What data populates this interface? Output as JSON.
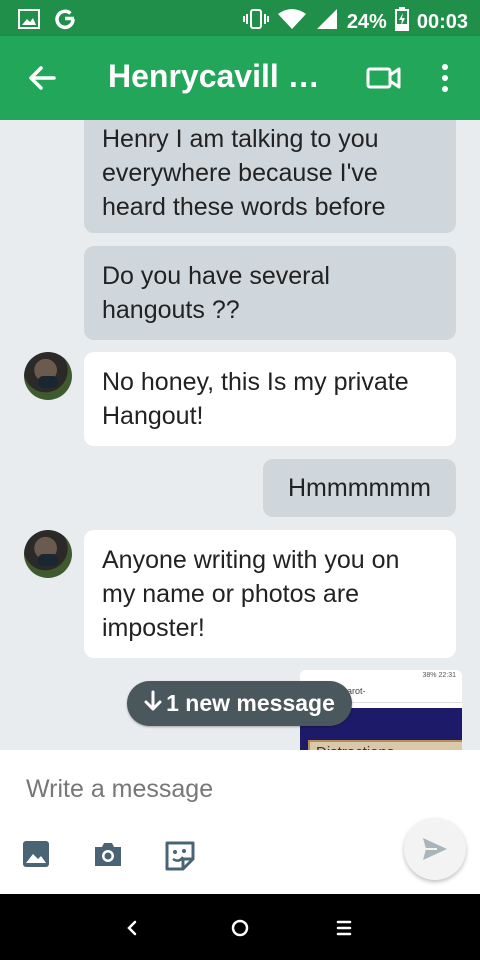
{
  "status_bar": {
    "battery_percent": "24%",
    "time": "00:03",
    "icons": [
      "gallery-icon",
      "google-g-icon",
      "vibrate-icon",
      "wifi-icon",
      "cell-signal-icon",
      "battery-charging-icon"
    ]
  },
  "header": {
    "title": "Henrycavill O...",
    "icons": [
      "back-arrow-icon",
      "video-call-icon",
      "more-vert-icon"
    ]
  },
  "messages": [
    {
      "direction": "out",
      "text": "Henry I am talking to you everywhere because I've heard these words before"
    },
    {
      "direction": "out",
      "text": "Do you have several hangouts ??"
    },
    {
      "direction": "in",
      "text": "No honey, this Is my private Hangout!"
    },
    {
      "direction": "out",
      "text": "Hmmmmmm"
    },
    {
      "direction": "in",
      "text": "Anyone writing with you on my name or photos are imposter!"
    }
  ],
  "screenshot_thumbnail": {
    "status_text": "38%  22:31",
    "url_text": "llate.com/tarot-",
    "card_text": "Distractions"
  },
  "new_message_pill": {
    "label": "1 new message",
    "icon": "arrow-down-icon"
  },
  "composer": {
    "placeholder": "Write a message",
    "icons": [
      "image-icon",
      "camera-icon",
      "sticker-icon",
      "send-icon"
    ]
  },
  "nav_bar": {
    "buttons": [
      "back",
      "home",
      "recents"
    ]
  },
  "colors": {
    "status_bar": "#1f8f49",
    "app_bar": "#22a65a",
    "outgoing_bubble": "#d0d7dc",
    "incoming_bubble": "#ffffff",
    "pill": "#4a575c"
  }
}
